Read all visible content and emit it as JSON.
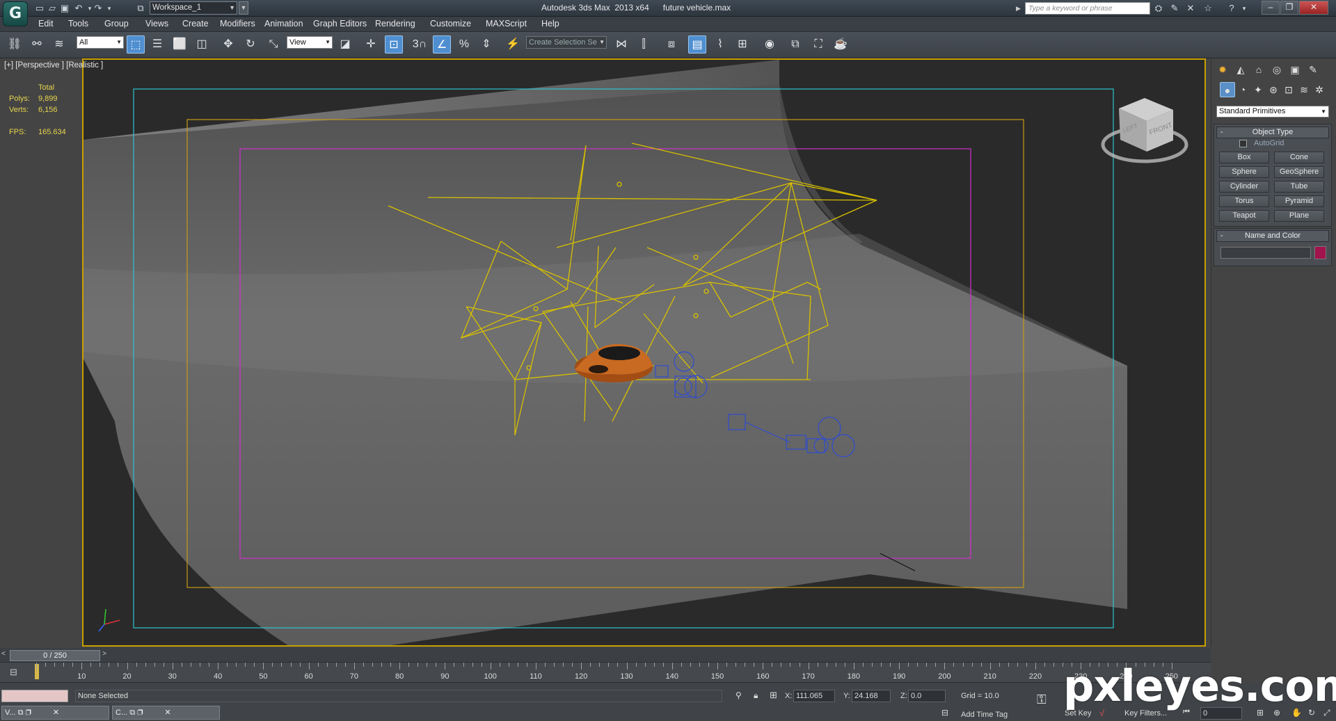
{
  "titlebar": {
    "workspace": "Workspace_1",
    "app_title": "Autodesk 3ds Max  2013 x64      future vehicle.max",
    "search_placeholder": "Type a keyword or phrase",
    "logo": "G"
  },
  "menu": [
    "Edit",
    "Tools",
    "Group",
    "Views",
    "Create",
    "Modifiers",
    "Animation",
    "Graph Editors",
    "Rendering",
    "Customize",
    "MAXScript",
    "Help"
  ],
  "toolbar": {
    "filter_value": "All",
    "ref_coord_value": "View",
    "selection_set_value": "Create Selection Se",
    "snap_label": "3",
    "percent_label": "%"
  },
  "viewport": {
    "label": "[+] [Perspective ] [Realistic ]",
    "stats": {
      "total_label": "Total",
      "polys_label": "Polys:",
      "polys_value": "9,899",
      "verts_label": "Verts:",
      "verts_value": "6,156",
      "fps_label": "FPS:",
      "fps_value": "165.634"
    },
    "viewcube": {
      "left": "LEFT",
      "front": "FRONT"
    }
  },
  "command_panel": {
    "dropdown": "Standard Primitives",
    "object_type_title": "Object Type",
    "autogrid_label": "AutoGrid",
    "buttons": [
      "Box",
      "Cone",
      "Sphere",
      "GeoSphere",
      "Cylinder",
      "Tube",
      "Torus",
      "Pyramid",
      "Teapot",
      "Plane"
    ],
    "name_color_title": "Name and Color",
    "name_value": "",
    "color": "#a0134d"
  },
  "timeline": {
    "slider_label": "0 / 250",
    "ticks": [
      "10",
      "20",
      "30",
      "40",
      "50",
      "60",
      "70",
      "80",
      "90",
      "100",
      "110",
      "120",
      "130",
      "140",
      "150",
      "160",
      "170",
      "180",
      "190",
      "200",
      "210",
      "220",
      "230",
      "240",
      "250"
    ]
  },
  "status": {
    "selection": "None Selected",
    "x_label": "X:",
    "x_value": "111.065",
    "y_label": "Y:",
    "y_value": "24.168",
    "z_label": "Z:",
    "z_value": "0.0",
    "grid": "Grid = 10.0",
    "add_time_tag": "Add Time Tag",
    "set_key": "Set Key",
    "key_filters": "Key Filters...",
    "frame_value": "0"
  },
  "taskbar": [
    "V...",
    "C..."
  ],
  "watermark": "pxleyes.com",
  "colors": {
    "accent_active": "#4f8fd1",
    "viewport_border": "#c8a000",
    "stats_text": "#e8d44d"
  }
}
